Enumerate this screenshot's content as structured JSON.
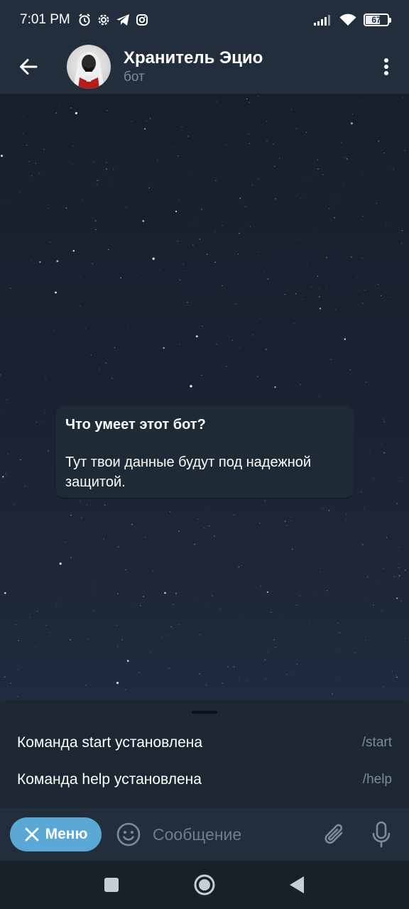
{
  "status_bar": {
    "time": "7:01 PM",
    "left_icons": [
      "alarm-icon",
      "settings-icon",
      "telegram-icon",
      "instagram-icon"
    ],
    "right_icons": [
      "signal-icon",
      "wifi-icon",
      "battery-icon"
    ],
    "battery_level": "67",
    "battery_fraction": 0.67
  },
  "header": {
    "title": "Хранитель Эцио",
    "subtitle": "бот"
  },
  "bot_info": {
    "title": "Что умеет этот бот?",
    "text": "Тут твои данные будут под надежной защитой."
  },
  "commands": [
    {
      "description": "Команда start установлена",
      "command": "/start"
    },
    {
      "description": "Команда help установлена",
      "command": "/help"
    }
  ],
  "input_bar": {
    "menu_label": "Меню",
    "placeholder": "Сообщение"
  },
  "colors": {
    "header_bg": "#222e3b",
    "accent": "#5aa8d6",
    "secondary_text": "#7c8a99"
  }
}
